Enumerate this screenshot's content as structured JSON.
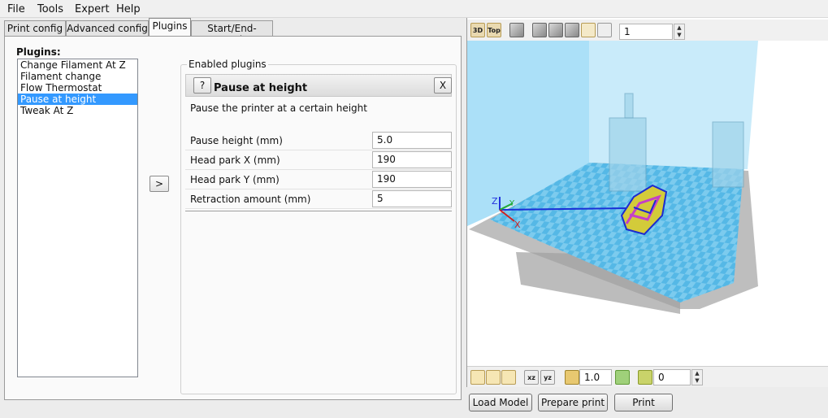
{
  "menu": [
    "File",
    "Tools",
    "Expert",
    "Help"
  ],
  "tabs": [
    "Print config",
    "Advanced config",
    "Plugins",
    "Start/End-GCode"
  ],
  "plugins_panel": {
    "title": "Plugins:",
    "items": [
      "Change Filament At Z",
      "Filament change",
      "Flow Thermostat",
      "Pause at height",
      "Tweak At Z"
    ],
    "move_button": ">"
  },
  "enabled_plugins": {
    "legend": "Enabled plugins",
    "help_button": "?",
    "remove_button": "X",
    "plugin_name": "Pause at height",
    "description": "Pause the printer at a certain height",
    "params": [
      {
        "label": "Pause height (mm)",
        "value": "5.0"
      },
      {
        "label": "Head park X (mm)",
        "value": "190"
      },
      {
        "label": "Head park Y (mm)",
        "value": "190"
      },
      {
        "label": "Retraction amount (mm)",
        "value": "5"
      }
    ]
  },
  "view_toolbar": {
    "icons": [
      "3D",
      "Top"
    ],
    "layer_value": "1"
  },
  "view_bottom_toolbar": {
    "icons": [
      "xz",
      "yz"
    ],
    "scale_value": "1.0",
    "rotate_value": "0"
  },
  "axis_labels": {
    "z": "Z",
    "y": "Y",
    "x": "X"
  },
  "buttons": {
    "load": "Load Model",
    "prepare": "Prepare print",
    "print": "Print"
  },
  "colors": {
    "selection": "#3399ff",
    "build_volume": "#8fd6f5",
    "plate": "#55b8e6",
    "base": "#b3b3b3"
  }
}
